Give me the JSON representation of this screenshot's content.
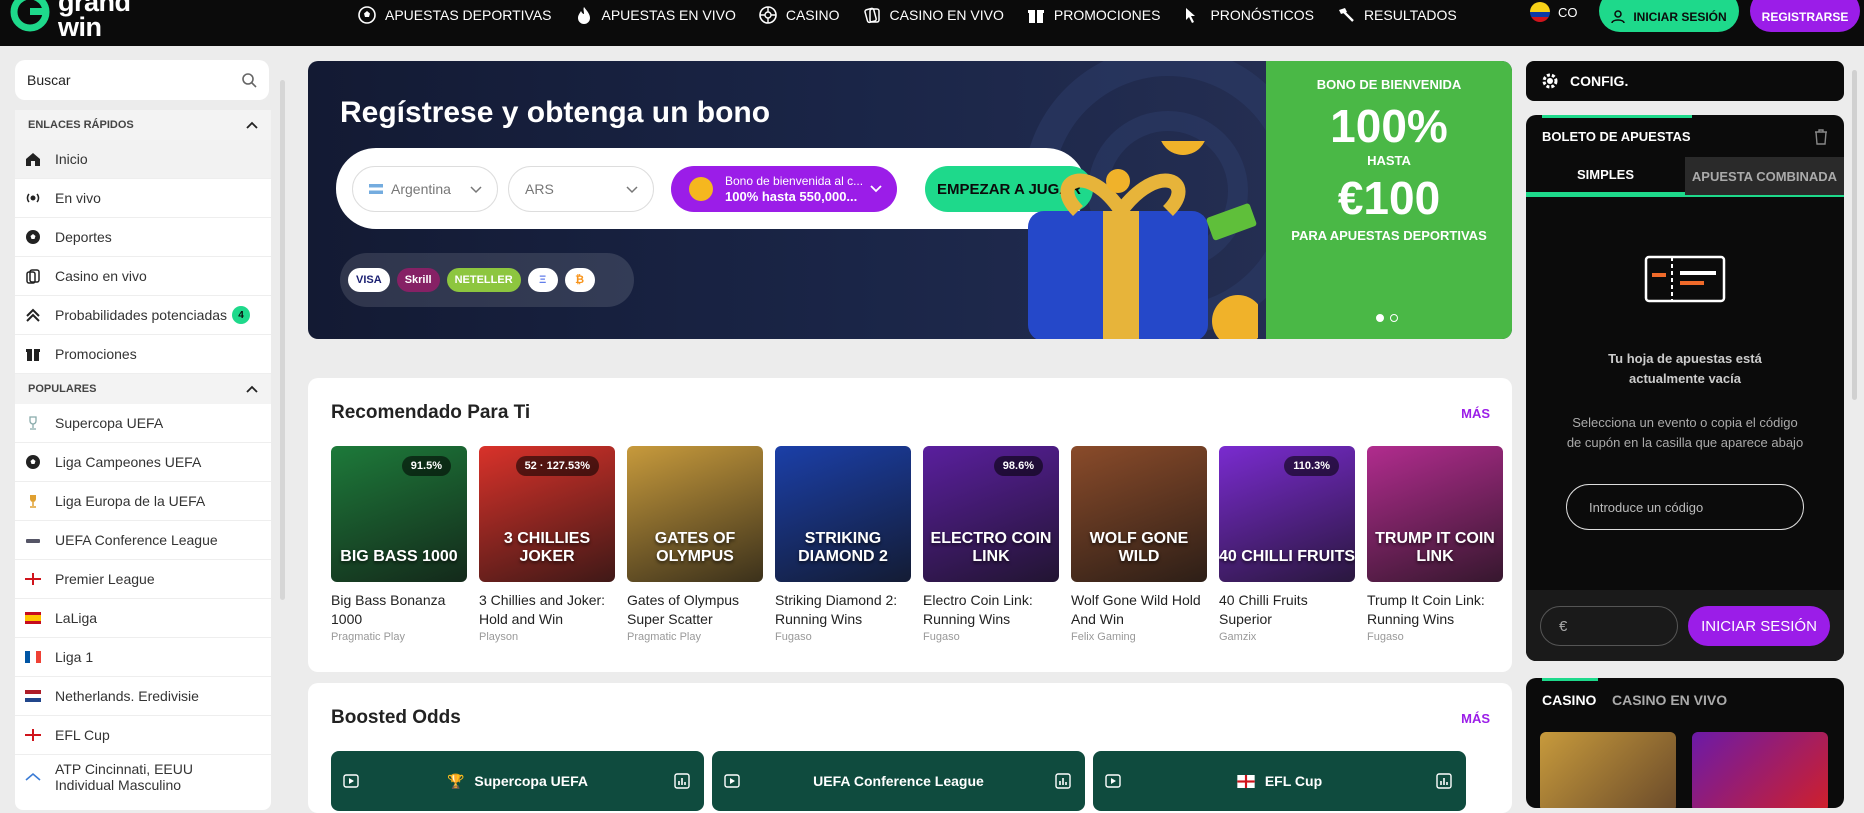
{
  "header": {
    "logo_text": "grand\nwin",
    "nav": [
      {
        "label": "APUESTAS DEPORTIVAS",
        "icon": "soccer-ball-icon"
      },
      {
        "label": "APUESTAS EN VIVO",
        "icon": "live-flame-icon"
      },
      {
        "label": "CASINO",
        "icon": "roulette-icon"
      },
      {
        "label": "CASINO EN VIVO",
        "icon": "cards-icon"
      },
      {
        "label": "PROMOCIONES",
        "icon": "gift-icon"
      },
      {
        "label": "PRONÓSTICOS",
        "icon": "cursor-icon"
      },
      {
        "label": "RESULTADOS",
        "icon": "hammer-icon"
      }
    ],
    "country": "CO",
    "login_label": "INICIAR SESIÓN",
    "register_label": "REGISTRARSE"
  },
  "sidebar": {
    "search_placeholder": "Buscar",
    "quick_title": "ENLACES RÁPIDOS",
    "quick": [
      {
        "label": "Inicio",
        "icon": "home-icon"
      },
      {
        "label": "En vivo",
        "icon": "live-icon"
      },
      {
        "label": "Deportes",
        "icon": "soccer-ball-icon"
      },
      {
        "label": "Casino en vivo",
        "icon": "cards-icon"
      },
      {
        "label": "Probabilidades potenciadas",
        "icon": "boost-icon",
        "badge": "4"
      },
      {
        "label": "Promociones",
        "icon": "gift-icon"
      }
    ],
    "popular_title": "POPULARES",
    "popular": [
      {
        "label": "Supercopa UEFA",
        "icon": "trophy-icon"
      },
      {
        "label": "Liga Campeones UEFA",
        "icon": "soccer-ball-icon"
      },
      {
        "label": "Liga Europa de la UEFA",
        "icon": "trophy-icon"
      },
      {
        "label": "UEFA Conference League",
        "icon": "league-icon"
      },
      {
        "label": "Premier League",
        "icon": "england-flag-icon"
      },
      {
        "label": "LaLiga",
        "icon": "spain-flag-icon"
      },
      {
        "label": "Liga 1",
        "icon": "france-flag-icon"
      },
      {
        "label": "Netherlands. Eredivisie",
        "icon": "netherlands-flag-icon"
      },
      {
        "label": "EFL Cup",
        "icon": "england-flag-icon"
      },
      {
        "label": "ATP Cincinnati, EEUU Individual Masculino",
        "icon": "atp-icon"
      }
    ]
  },
  "banner": {
    "title": "Regístrese y obtenga un bono",
    "country_select": "Argentina",
    "currency_select": "ARS",
    "bonus_line1": "Bono de bienvenida al c...",
    "bonus_line2": "100% hasta 550,000...",
    "cta": "EMPEZAR A JUGAR",
    "payments": [
      "VISA",
      "Skrill",
      "NETELLER",
      "Ξ",
      "₿"
    ],
    "promo_title": "BONO DE BIENVENIDA",
    "promo_pct": "100%",
    "promo_hasta": "HASTA",
    "promo_amount": "€100",
    "promo_sub": "PARA APUESTAS DEPORTIVAS"
  },
  "recommended": {
    "title": "Recomendado Para Ti",
    "more": "MÁS",
    "games": [
      {
        "name": "Big Bass Bonanza 1000",
        "provider": "Pragmatic Play",
        "rtp": "91.5%",
        "art": "BIG BASS 1000",
        "bg": "#1d7a3a"
      },
      {
        "name": "3 Chillies and Joker: Hold and Win",
        "provider": "Playson",
        "rtp": "52 · 127.53%",
        "art": "3 CHILLIES JOKER",
        "bg": "#d9322a"
      },
      {
        "name": "Gates of Olympus Super Scatter",
        "provider": "Pragmatic Play",
        "rtp": "",
        "art": "GATES OF OLYMPUS",
        "bg": "#c79a3c"
      },
      {
        "name": "Striking Diamond 2: Running Wins",
        "provider": "Fugaso",
        "rtp": "",
        "art": "STRIKING DIAMOND 2",
        "bg": "#1b3fa8"
      },
      {
        "name": "Electro Coin Link: Running Wins",
        "provider": "Fugaso",
        "rtp": "98.6%",
        "art": "ELECTRO COIN LINK",
        "bg": "#5a1f9e"
      },
      {
        "name": "Wolf Gone Wild Hold And Win",
        "provider": "Felix Gaming",
        "rtp": "",
        "art": "WOLF GONE WILD",
        "bg": "#8a4b2a"
      },
      {
        "name": "40 Chilli Fruits Superior",
        "provider": "Gamzix",
        "rtp": "110.3%",
        "art": "40 CHILLI FRUITS",
        "bg": "#7a2bd0"
      },
      {
        "name": "Trump It Coin Link: Running Wins",
        "provider": "Fugaso",
        "rtp": "",
        "art": "TRUMP IT COIN LINK",
        "bg": "#b12c8e"
      }
    ]
  },
  "boosted": {
    "title": "Boosted Odds",
    "more": "MÁS",
    "cards": [
      "Supercopa UEFA",
      "UEFA Conference League",
      "EFL Cup"
    ]
  },
  "config": {
    "label": "CONFIG."
  },
  "slip": {
    "title": "BOLETO DE APUESTAS",
    "tab_single": "SIMPLES",
    "tab_combo": "APUESTA COMBINADA",
    "empty_title": "Tu hoja de apuestas está actualmente vacía",
    "empty_desc": "Selecciona un evento o copia el código de cupón en la casilla que aparece abajo",
    "code_placeholder": "Introduce un código",
    "amount_placeholder": "€",
    "login_label": "INICIAR SESIÓN"
  },
  "casino_panel": {
    "tab1": "CASINO",
    "tab2": "CASINO EN VIVO"
  }
}
